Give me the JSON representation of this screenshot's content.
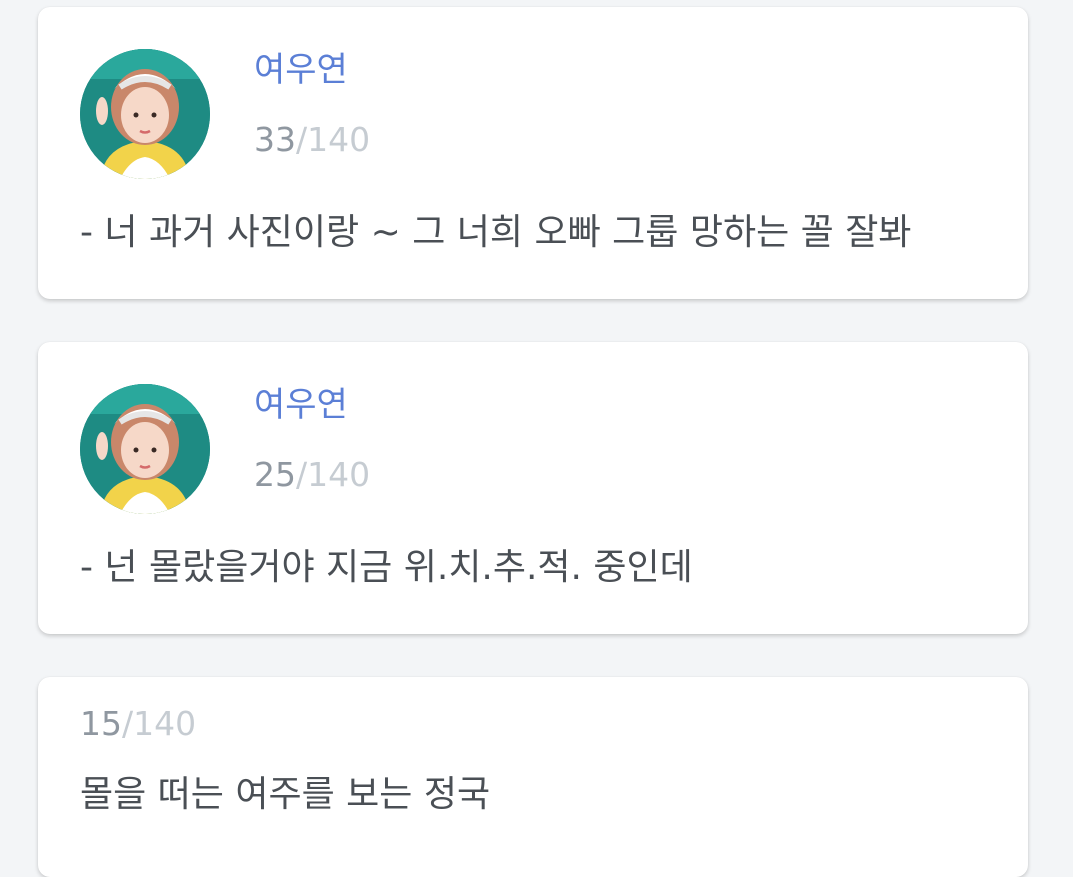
{
  "cards": [
    {
      "author": "여우연",
      "count": "33",
      "limit": "/140",
      "message": "- 너 과거 사진이랑 ~ 그 너희 오빠 그룹 망하는 꼴 잘봐"
    },
    {
      "author": "여우연",
      "count": "25",
      "limit": "/140",
      "message": "- 넌 몰랐을거야 지금 위.치.추.적. 중인데"
    },
    {
      "count": "15",
      "limit": "/140",
      "message": "몰을 떠는 여주를 보는 정국"
    }
  ],
  "colors": {
    "author": "#5b7fd6",
    "count_current": "#8f97a0",
    "count_limit": "#c6ccd2",
    "message": "#4a4f55"
  }
}
